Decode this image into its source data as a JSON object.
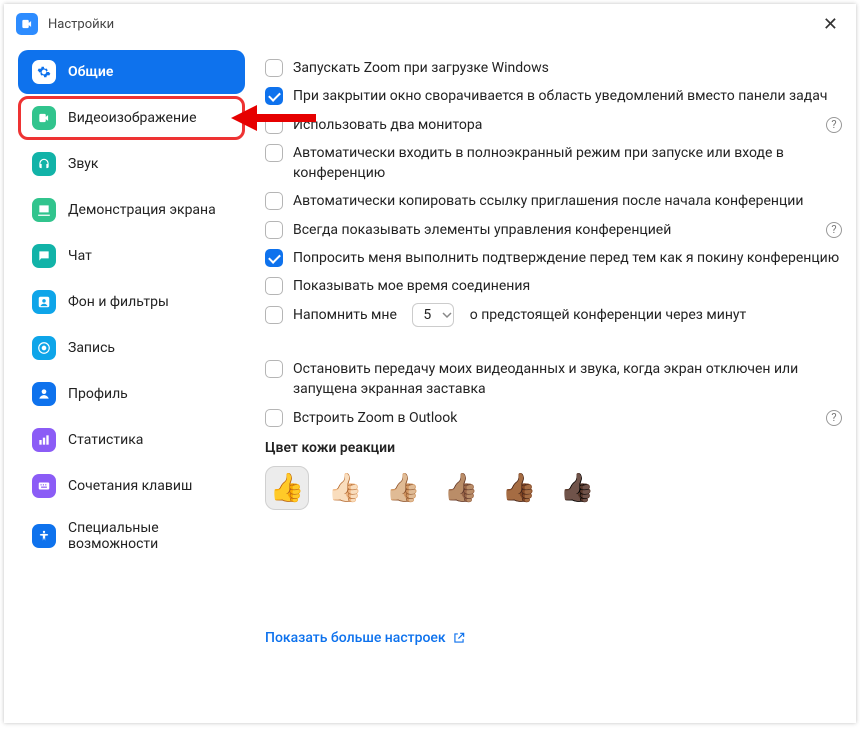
{
  "window": {
    "title": "Настройки"
  },
  "sidebar": {
    "items": [
      {
        "label": "Общие"
      },
      {
        "label": "Видеоизображение"
      },
      {
        "label": "Звук"
      },
      {
        "label": "Демонстрация экрана"
      },
      {
        "label": "Чат"
      },
      {
        "label": "Фон и фильтры"
      },
      {
        "label": "Запись"
      },
      {
        "label": "Профиль"
      },
      {
        "label": "Статистика"
      },
      {
        "label": "Сочетания клавиш"
      },
      {
        "label": "Специальные возможности"
      }
    ]
  },
  "options": {
    "start_on_windows": "Запускать Zoom при загрузке Windows",
    "minimize_to_tray": "При закрытии окно сворачивается в область уведомлений вместо панели задач",
    "dual_monitors": "Использовать два монитора",
    "auto_fullscreen": "Автоматически входить в полноэкранный режим при запуске или входе в конференцию",
    "auto_copy_invite": "Автоматически копировать ссылку приглашения после начала конференции",
    "always_show_controls": "Всегда показывать элементы управления конференцией",
    "confirm_leave": "Попросить меня выполнить подтверждение перед тем как я покину конференцию",
    "show_connect_time": "Показывать мое время соединения",
    "remind_pre": "Напомнить мне",
    "remind_value": "5",
    "remind_post": "о предстоящей конференции через минут",
    "stop_av_on_lock": "Остановить передачу моих видеоданных и звука, когда экран отключен или запущена экранная заставка",
    "outlook": "Встроить Zoom в Outlook"
  },
  "checked": {
    "start_on_windows": false,
    "minimize_to_tray": true,
    "dual_monitors": false,
    "auto_fullscreen": false,
    "auto_copy_invite": false,
    "always_show_controls": false,
    "confirm_leave": true,
    "show_connect_time": false,
    "remind": false,
    "stop_av_on_lock": false,
    "outlook": false
  },
  "skin": {
    "title": "Цвет кожи реакции",
    "tones": [
      "👍",
      "👍🏻",
      "👍🏼",
      "👍🏽",
      "👍🏾",
      "👍🏿"
    ],
    "selected_index": 0
  },
  "more_link": "Показать больше настроек"
}
